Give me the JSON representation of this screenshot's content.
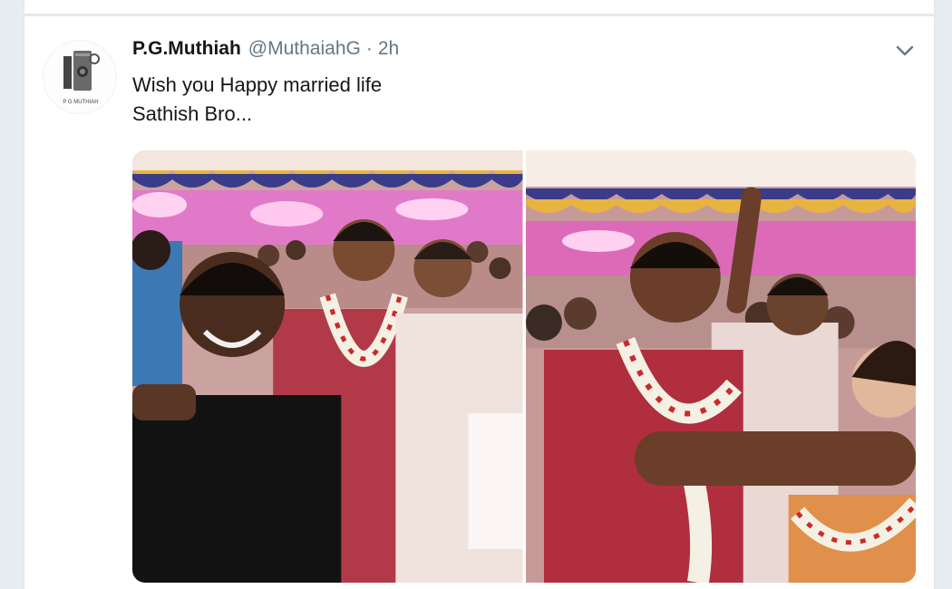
{
  "tweet": {
    "author_name": "P.G.Muthiah",
    "author_handle": "@MuthaiahG",
    "separator": "·",
    "timestamp": "2h",
    "text_line1": "Wish you Happy married life",
    "text_line2": "Sathish Bro...",
    "avatar_caption": "P G MUTHIAH"
  },
  "media": {
    "photos": [
      {
        "alt_label": "wedding-photo-selfie"
      },
      {
        "alt_label": "wedding-photo-garland"
      }
    ]
  },
  "colors": {
    "text_primary": "#14171a",
    "text_secondary": "#657786",
    "background": "#e6ecf0",
    "card": "#ffffff"
  },
  "icons": {
    "more": "chevron-down-icon",
    "avatar": "camera-logo-icon"
  }
}
